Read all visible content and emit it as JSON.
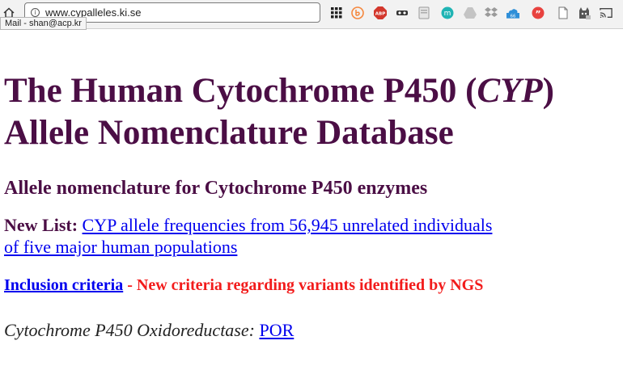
{
  "browser": {
    "url": "www.cypalleles.ki.se",
    "tooltip": "Mail - shan@acp.kr",
    "extensions": {
      "badge_count": "66",
      "colors": {
        "b": "#f5873d",
        "abp": "#d3372c",
        "m": "#1fb4b4",
        "quote": "#e8423f",
        "cloud": "#2f8fd8"
      }
    }
  },
  "page": {
    "title_line1_pre": "The Human Cytochrome P450 (",
    "title_line1_italic": "CYP",
    "title_line1_post": ")",
    "title_line2": "Allele Nomenclature Database",
    "subtitle": "Allele nomenclature for Cytochrome P450 enzymes",
    "new_list_label": "New List:",
    "new_list_link_line1": "CYP allele frequencies from 56,945 unrelated individuals",
    "new_list_link_line2": "of five major human populations",
    "inclusion_link": "Inclusion criteria",
    "inclusion_note": " - New criteria regarding variants identified by NGS",
    "por_label": "Cytochrome P450 Oxidoreductase: ",
    "por_link": "POR"
  },
  "colors": {
    "heading": "#4b0e45",
    "link": "#0000ee",
    "alert": "#f21b1b"
  }
}
